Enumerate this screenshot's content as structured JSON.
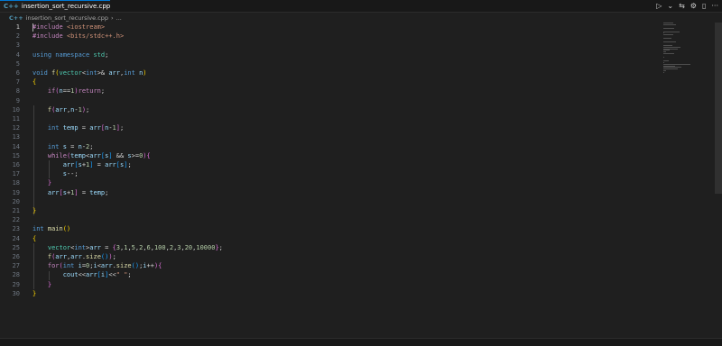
{
  "tab": {
    "filename": "insertion_sort_recursive.cpp",
    "icon": "C++"
  },
  "breadcrumb": {
    "filename": "insertion_sort_recursive.cpp",
    "more": "..."
  },
  "actions": {
    "run": "▷",
    "run_dropdown": "⌄",
    "split": "⇆",
    "settings": "⚙",
    "layout": "▯",
    "more": "···"
  },
  "editor": {
    "active_line": 1
  },
  "status": {
    "text": ""
  }
}
